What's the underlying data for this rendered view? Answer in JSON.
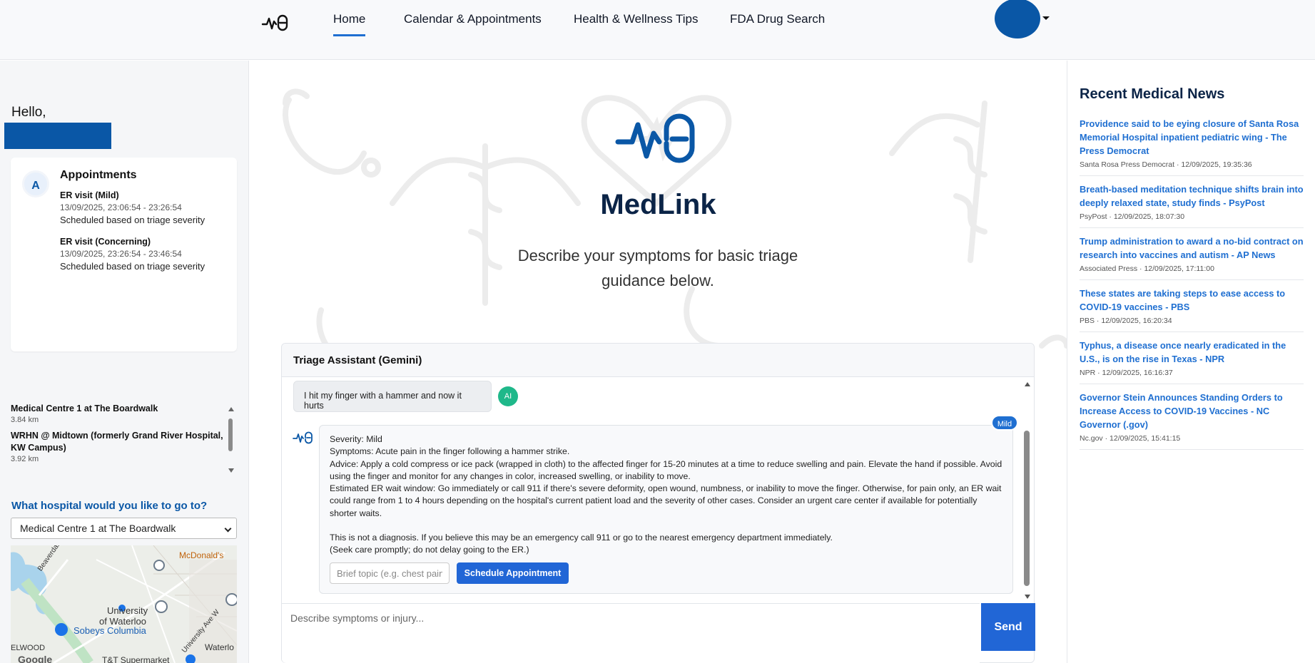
{
  "nav": {
    "items": [
      {
        "label": "Home",
        "active": true
      },
      {
        "label": "Calendar & Appointments",
        "active": false
      },
      {
        "label": "Health & Wellness Tips",
        "active": false
      },
      {
        "label": "FDA Drug Search",
        "active": false
      }
    ]
  },
  "sidebar": {
    "greeting": "Hello,",
    "appointments": {
      "badge": "A",
      "title": "Appointments",
      "entries": [
        {
          "title": "ER visit (Mild)",
          "time": "13/09/2025, 23:06:54 - 23:26:54",
          "note": "Scheduled based on triage severity"
        },
        {
          "title": "ER visit (Concerning)",
          "time": "13/09/2025, 23:26:54 - 23:46:54",
          "note": "Scheduled based on triage severity"
        }
      ]
    },
    "hospitals": [
      {
        "name": "Medical Centre 1 at The Boardwalk",
        "distance": "3.84 km"
      },
      {
        "name": "WRHN @ Midtown (formerly Grand River Hospital, KW Campus)",
        "distance": "3.92 km"
      }
    ],
    "hospital_question": "What hospital would you like to go to?",
    "hospital_selected": "Medical Centre 1 at The Boardwalk",
    "map_labels": {
      "mcdonalds": "McDonald's",
      "beaverdale": "Beaverdale Rd",
      "university": "University",
      "of_waterloo": "of Waterloo",
      "sobeys": "Sobeys Columbia",
      "university_ave": "University Ave W",
      "elwood": "ELWOOD",
      "waterloo": "Waterlo",
      "tt": "T&T Supermarket",
      "google": "Google"
    }
  },
  "hero": {
    "title": "MedLink",
    "subtitle": "Describe your symptoms for basic triage guidance below."
  },
  "chat": {
    "header": "Triage Assistant (Gemini)",
    "user_message": "I hit my finger with a hammer and now it hurts",
    "ai_label": "AI",
    "severity_badge": "Mild",
    "response_lines": [
      "Severity: Mild",
      "Symptoms: Acute pain in the finger following a hammer strike.",
      "Advice: Apply a cold compress or ice pack (wrapped in cloth) to the affected finger for 15-20 minutes at a time to reduce swelling and pain. Elevate the hand if possible. Avoid using the finger and monitor for any changes in color, increased swelling, or inability to move.",
      "Estimated ER wait window: Go immediately or call 911 if there's severe deformity, open wound, numbness, or inability to move the finger. Otherwise, for pain only, an ER wait could range from 1 to 4 hours depending on the hospital's current patient load and the severity of other cases. Consider an urgent care center if available for potentially shorter waits.",
      "",
      "This is not a diagnosis. If you believe this may be an emergency call 911 or go to the nearest emergency department immediately.",
      "(Seek care promptly; do not delay going to the ER.)"
    ],
    "topic_placeholder": "Brief topic (e.g. chest pain)",
    "schedule_label": "Schedule Appointment",
    "input_placeholder": "Describe symptoms or injury...",
    "send_label": "Send"
  },
  "news": {
    "title": "Recent Medical News",
    "items": [
      {
        "headline": "Providence said to be eying closure of Santa Rosa Memorial Hospital inpatient pediatric wing - The Press Democrat",
        "meta": "Santa Rosa Press Democrat · 12/09/2025, 19:35:36"
      },
      {
        "headline": "Breath-based meditation technique shifts brain into deeply relaxed state, study finds - PsyPost",
        "meta": "PsyPost · 12/09/2025, 18:07:30"
      },
      {
        "headline": "Trump administration to award a no-bid contract on research into vaccines and autism - AP News",
        "meta": "Associated Press · 12/09/2025, 17:11:00"
      },
      {
        "headline": "These states are taking steps to ease access to COVID-19 vaccines - PBS",
        "meta": "PBS · 12/09/2025, 16:20:34"
      },
      {
        "headline": "Typhus, a disease once nearly eradicated in the U.S., is on the rise in Texas - NPR",
        "meta": "NPR · 12/09/2025, 16:16:37"
      },
      {
        "headline": "Governor Stein Announces Standing Orders to Increase Access to COVID-19 Vaccines - NC Governor (.gov)",
        "meta": "Nc.gov · 12/09/2025, 15:41:15"
      }
    ]
  },
  "colors": {
    "brand": "#0a57a6",
    "accent": "#2166d6",
    "ai": "#1fb88a"
  }
}
